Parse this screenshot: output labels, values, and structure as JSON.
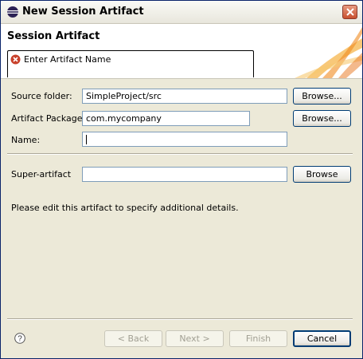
{
  "window": {
    "title": "New Session Artifact",
    "close_icon": "close-icon"
  },
  "banner": {
    "title": "Session Artifact",
    "message": "Enter Artifact Name",
    "status_color": "#c8402a"
  },
  "form": {
    "source_folder": {
      "label": "Source folder:",
      "value": "SimpleProject/src",
      "button": "Browse..."
    },
    "artifact_package": {
      "label": "Artifact Package:",
      "value": "com.mycompany",
      "button": "Browse..."
    },
    "name": {
      "label": "Name:",
      "value": ""
    },
    "super_artifact": {
      "label": "Super-artifact",
      "value": "",
      "button": "Browse"
    },
    "hint": "Please edit this artifact to specify additional details."
  },
  "footer": {
    "help_icon": "help-icon",
    "back": "< Back",
    "next": "Next >",
    "finish": "Finish",
    "cancel": "Cancel"
  }
}
